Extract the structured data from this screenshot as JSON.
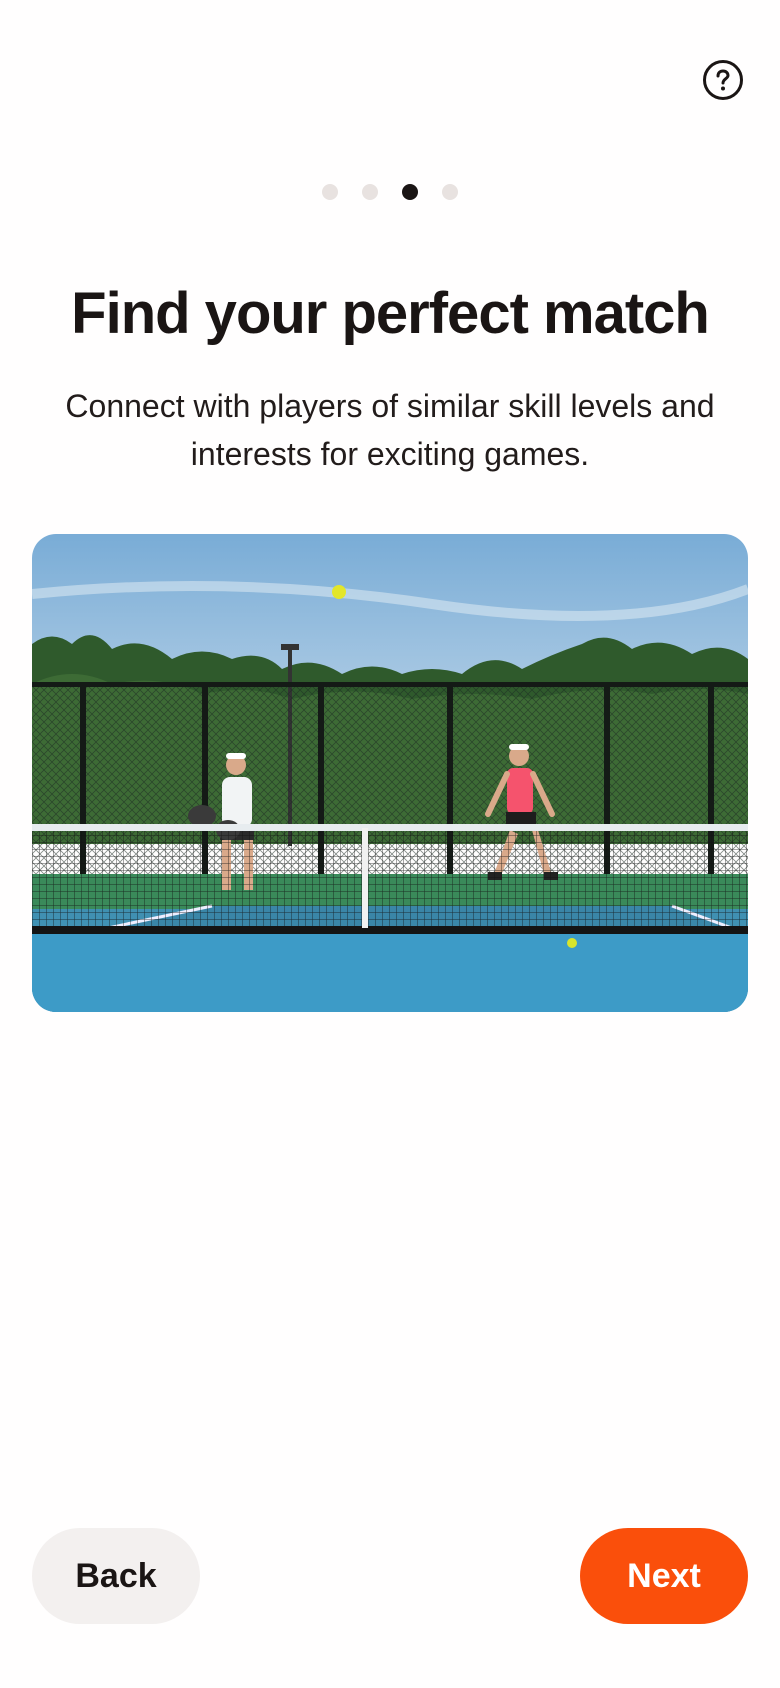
{
  "header": {
    "help_icon": "question-circle-icon"
  },
  "onboarding": {
    "total_steps": 4,
    "current_step": 3,
    "title": "Find your perfect match",
    "description": "Connect with players of similar skill levels and interests for exciting games."
  },
  "footer": {
    "back_label": "Back",
    "next_label": "Next"
  },
  "colors": {
    "accent": "#fa4f0b",
    "dot_active": "#1a1514",
    "dot_inactive": "#e8e2e0",
    "back_bg": "#f3f0ef"
  }
}
